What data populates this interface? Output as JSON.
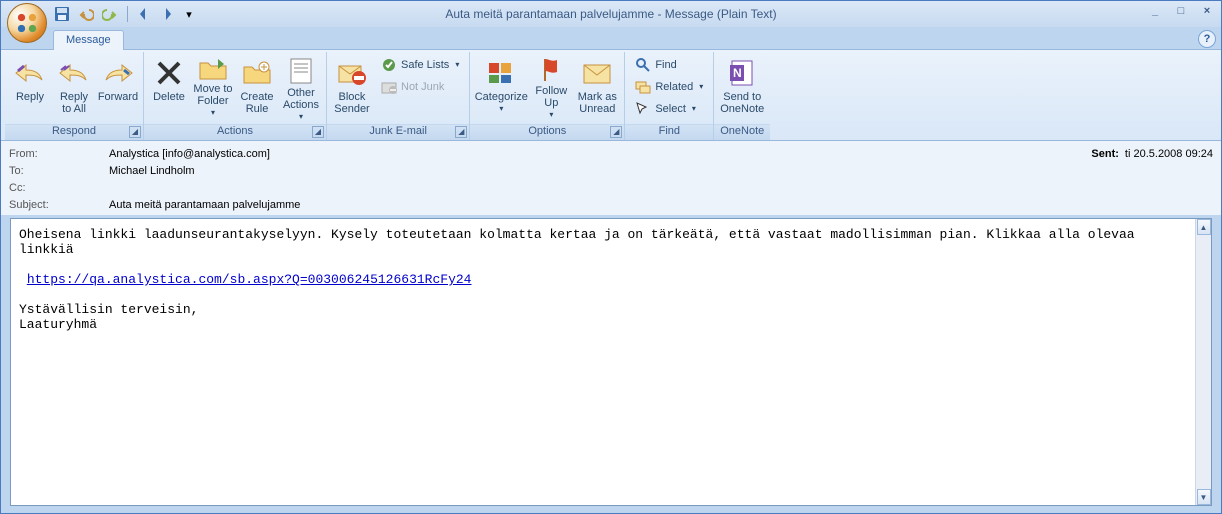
{
  "title": "Auta meitä parantamaan palvelujamme - Message (Plain Text)",
  "tab": {
    "message": "Message"
  },
  "ribbon": {
    "respond": {
      "label": "Respond",
      "reply": "Reply",
      "reply_all": "Reply\nto All",
      "forward": "Forward"
    },
    "actions": {
      "label": "Actions",
      "delete": "Delete",
      "move": "Move to\nFolder",
      "rule": "Create\nRule",
      "other": "Other\nActions"
    },
    "junk": {
      "label": "Junk E-mail",
      "block": "Block\nSender",
      "safe": "Safe Lists",
      "notjunk": "Not Junk"
    },
    "options": {
      "label": "Options",
      "categorize": "Categorize",
      "followup": "Follow\nUp",
      "unread": "Mark as\nUnread"
    },
    "find": {
      "label": "Find",
      "find": "Find",
      "related": "Related",
      "select": "Select"
    },
    "onenote": {
      "label": "OneNote",
      "send": "Send to\nOneNote"
    }
  },
  "header": {
    "from_lbl": "From:",
    "to_lbl": "To:",
    "cc_lbl": "Cc:",
    "subject_lbl": "Subject:",
    "from": "Analystica [info@analystica.com]",
    "to": "Michael Lindholm",
    "cc": "",
    "subject": "Auta meitä parantamaan palvelujamme",
    "sent_lbl": "Sent:",
    "sent": "ti 20.5.2008 09:24"
  },
  "body": {
    "p1": "Oheisena linkki laadunseurantakyselyyn. Kysely toteutetaan kolmatta kertaa ja on tärkeätä, että vastaat madollisimman pian. Klikkaa alla olevaa linkkiä",
    "link": "https://qa.analystica.com/sb.aspx?Q=003006245126631RcFy24",
    "p2": "Ystävällisin terveisin,",
    "p3": "Laaturyhmä"
  }
}
